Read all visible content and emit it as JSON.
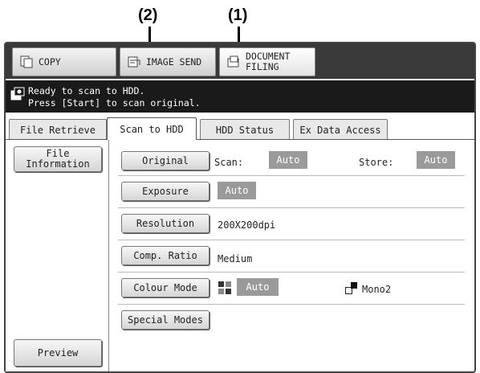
{
  "callouts": {
    "c2": "(2)",
    "c1": "(1)"
  },
  "modes": {
    "copy": "COPY",
    "image_send": "IMAGE SEND",
    "doc_filing_l1": "DOCUMENT",
    "doc_filing_l2": "FILING"
  },
  "message": {
    "line1": "Ready to scan to HDD.",
    "line2": "Press [Start] to scan original."
  },
  "tabs": {
    "file_retrieve": "File Retrieve",
    "scan_to_hdd": "Scan to HDD",
    "hdd_status": "HDD Status",
    "ex_data_access": "Ex Data Access"
  },
  "sidebar": {
    "file_info_l1": "File",
    "file_info_l2": "Information",
    "preview": "Preview"
  },
  "settings": {
    "original": {
      "label": "Original",
      "scan_label": "Scan:",
      "scan_value": "Auto",
      "store_label": "Store:",
      "store_value": "Auto"
    },
    "exposure": {
      "label": "Exposure",
      "value": "Auto"
    },
    "resolution": {
      "label": "Resolution",
      "value": "200X200dpi"
    },
    "comp_ratio": {
      "label": "Comp. Ratio",
      "value": "Medium"
    },
    "colour_mode": {
      "label": "Colour Mode",
      "colour_value": "Auto",
      "mono_value": "Mono2"
    },
    "special_modes": {
      "label": "Special Modes"
    }
  },
  "icons": [
    "copy-icon",
    "image-send-icon",
    "document-filing-icon",
    "message-icon",
    "colour-icon",
    "mono-icon"
  ]
}
